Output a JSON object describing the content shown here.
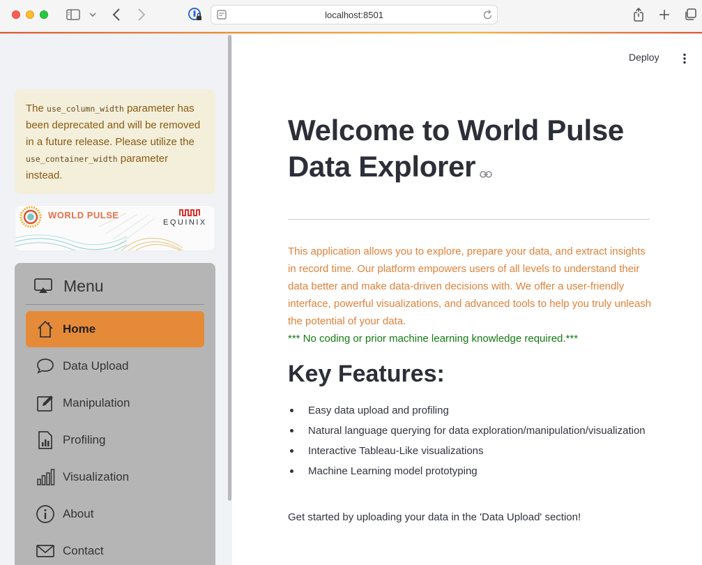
{
  "browser": {
    "url": "localhost:8501"
  },
  "sidebar": {
    "warning": {
      "part1": "The ",
      "code1": "use_column_width",
      "part2": " parameter has been deprecated and will be removed in a future release. Please utilize the ",
      "code2": "use_container_width",
      "part3": " parameter instead."
    },
    "banner": {
      "left_text": "WORLD PULSE",
      "right_text": "EQUINIX"
    },
    "menu": {
      "title": "Menu",
      "items": [
        {
          "label": "Home",
          "icon": "house-icon",
          "active": true
        },
        {
          "label": "Data Upload",
          "icon": "chat-bubble-icon",
          "active": false
        },
        {
          "label": "Manipulation",
          "icon": "pencil-square-icon",
          "active": false
        },
        {
          "label": "Profiling",
          "icon": "file-bar-chart-icon",
          "active": false
        },
        {
          "label": "Visualization",
          "icon": "bar-chart-icon",
          "active": false
        },
        {
          "label": "About",
          "icon": "info-circle-icon",
          "active": false
        },
        {
          "label": "Contact",
          "icon": "envelope-icon",
          "active": false
        }
      ]
    }
  },
  "header": {
    "deploy_label": "Deploy"
  },
  "main": {
    "title": "Welcome to World Pulse Data Explorer",
    "intro": "This application allows you to explore, prepare your data, and extract insights in record time. Our platform empowers users of all levels to understand their data better and make data-driven decisions with. We offer a user-friendly interface, powerful visualizations, and advanced tools to help you truly unleash the potential of your data.",
    "no_coding": "*** No coding or prior machine learning knowledge required.***",
    "features_heading": "Key Features:",
    "features": [
      "Easy data upload and profiling",
      "Natural language querying for data exploration/manipulation/visualization",
      "Interactive Tableau-Like visualizations",
      "Machine Learning model prototyping"
    ],
    "get_started": "Get started by uploading your data in the 'Data Upload' section!"
  },
  "colors": {
    "accent": "#e58a39",
    "intro_text": "#e0823a",
    "success_text": "#137a13",
    "warning_bg": "#f3efdb",
    "warning_text": "#8a5a10"
  }
}
